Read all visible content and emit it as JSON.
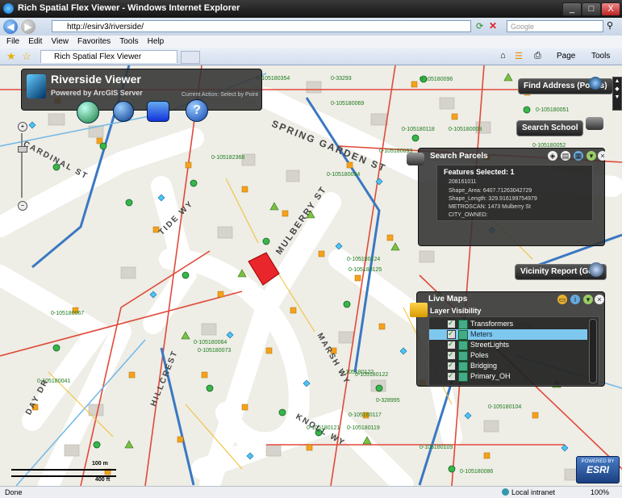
{
  "window": {
    "title": "Rich Spatial Flex Viewer - Windows Internet Explorer",
    "min": "_",
    "max": "□",
    "close": "X"
  },
  "address": {
    "url": "http://esirv3/riverside/",
    "search_placeholder": "Google"
  },
  "menu": [
    "File",
    "Edit",
    "View",
    "Favorites",
    "Tools",
    "Help"
  ],
  "tabs": {
    "active": "Rich Spatial Flex Viewer"
  },
  "toolbar_right": {
    "page": "Page",
    "tools": "Tools"
  },
  "viewer": {
    "title": "Riverside Viewer",
    "subtitle": "Powered by ArcGIS Server",
    "current_action": "Current Action: Select by Point"
  },
  "widgets": {
    "find_address": "Find Address (Points)",
    "search_school": "Search School",
    "vicinity_report": "Vicinity Report (Geor"
  },
  "search_parcels": {
    "title": "Search Parcels",
    "features_selected": "Features Selected: 1",
    "lines": [
      "208161011",
      "Shape_Area: 6407.71263042729",
      "Shape_Length: 329.916199754979",
      "METROSCAN: 1473  Mulberry St",
      "CITY_OWNED:"
    ]
  },
  "live_maps": {
    "title": "Live Maps",
    "layer_visibility": "Layer Visibility",
    "layers": [
      {
        "name": "Transformers",
        "checked": true,
        "selected": false
      },
      {
        "name": "Meters",
        "checked": true,
        "selected": true
      },
      {
        "name": "StreetLights",
        "checked": true,
        "selected": false
      },
      {
        "name": "Poles",
        "checked": true,
        "selected": false
      },
      {
        "name": "Bridging",
        "checked": true,
        "selected": false
      },
      {
        "name": "Primary_OH",
        "checked": true,
        "selected": false
      }
    ]
  },
  "streets": [
    "SPRING GARDEN ST",
    "MULBERRY ST",
    "CARDINAL ST",
    "TIDE WY",
    "MARSH WY",
    "KNOLL WY",
    "HILLCREST",
    "DAY DR"
  ],
  "map_labels": [
    "0-105180354",
    "0-33293",
    "0-105180069",
    "0-105180051",
    "0-105180118",
    "0-105180094",
    "0-105180124",
    "0-105180052",
    "0-105180125",
    "0-105180093",
    "0-105180096",
    "0-105180009",
    "0-105182368",
    "0-105180067",
    "0-105180041",
    "0-105180122",
    "0-105180119",
    "0-105180117",
    "0-105180109",
    "0-105180104",
    "0-105180086",
    "0-328995",
    "0-105180064",
    "0-105180073",
    "0-105180122",
    "0-105180121"
  ],
  "scale": {
    "top": "100 m",
    "bottom": "400 ft"
  },
  "esri": {
    "powered": "POWERED BY",
    "brand": "ESRI"
  },
  "status": {
    "left": "Done",
    "zone": "Local intranet",
    "zoom": "100%"
  },
  "colors": {
    "road_blue": "#3a78c2",
    "road_red": "#e04a3a",
    "parcel_highlight": "#e8262b",
    "meter_orange": "#f5a21a",
    "pole_green": "#39b54a",
    "light_blue": "#4fc3f7"
  }
}
